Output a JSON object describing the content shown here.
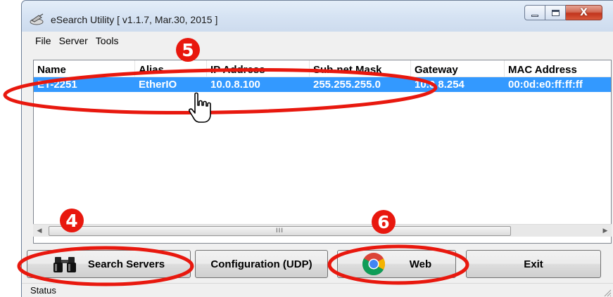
{
  "window": {
    "title": "eSearch Utility [ v1.1.7, Mar.30, 2015 ]",
    "close_glyph": "X"
  },
  "menu": [
    "File",
    "Server",
    "Tools"
  ],
  "table": {
    "columns": [
      "Name",
      "Alias",
      "IP Address",
      "Sub-net Mask",
      "Gateway",
      "MAC Address"
    ],
    "rows": [
      [
        "ET-2251",
        "EtherIO",
        "10.0.8.100",
        "255.255.255.0",
        "10.0.8.254",
        "00:0d:e0:ff:ff:ff"
      ]
    ],
    "selected_row": 0
  },
  "scrollbar": {
    "thumb_grip": "III"
  },
  "buttons": {
    "search": "Search Servers",
    "config": "Configuration (UDP)",
    "web": "Web",
    "exit": "Exit"
  },
  "status": "Status",
  "annotations": {
    "badges": [
      "4",
      "5",
      "6"
    ],
    "color": "#e8180e"
  },
  "colors": {
    "selection": "#3399ff",
    "annotation_red": "#e8180e"
  },
  "icons": [
    "app-icon",
    "binoculars-icon",
    "chrome-icon",
    "hand-cursor-icon"
  ]
}
